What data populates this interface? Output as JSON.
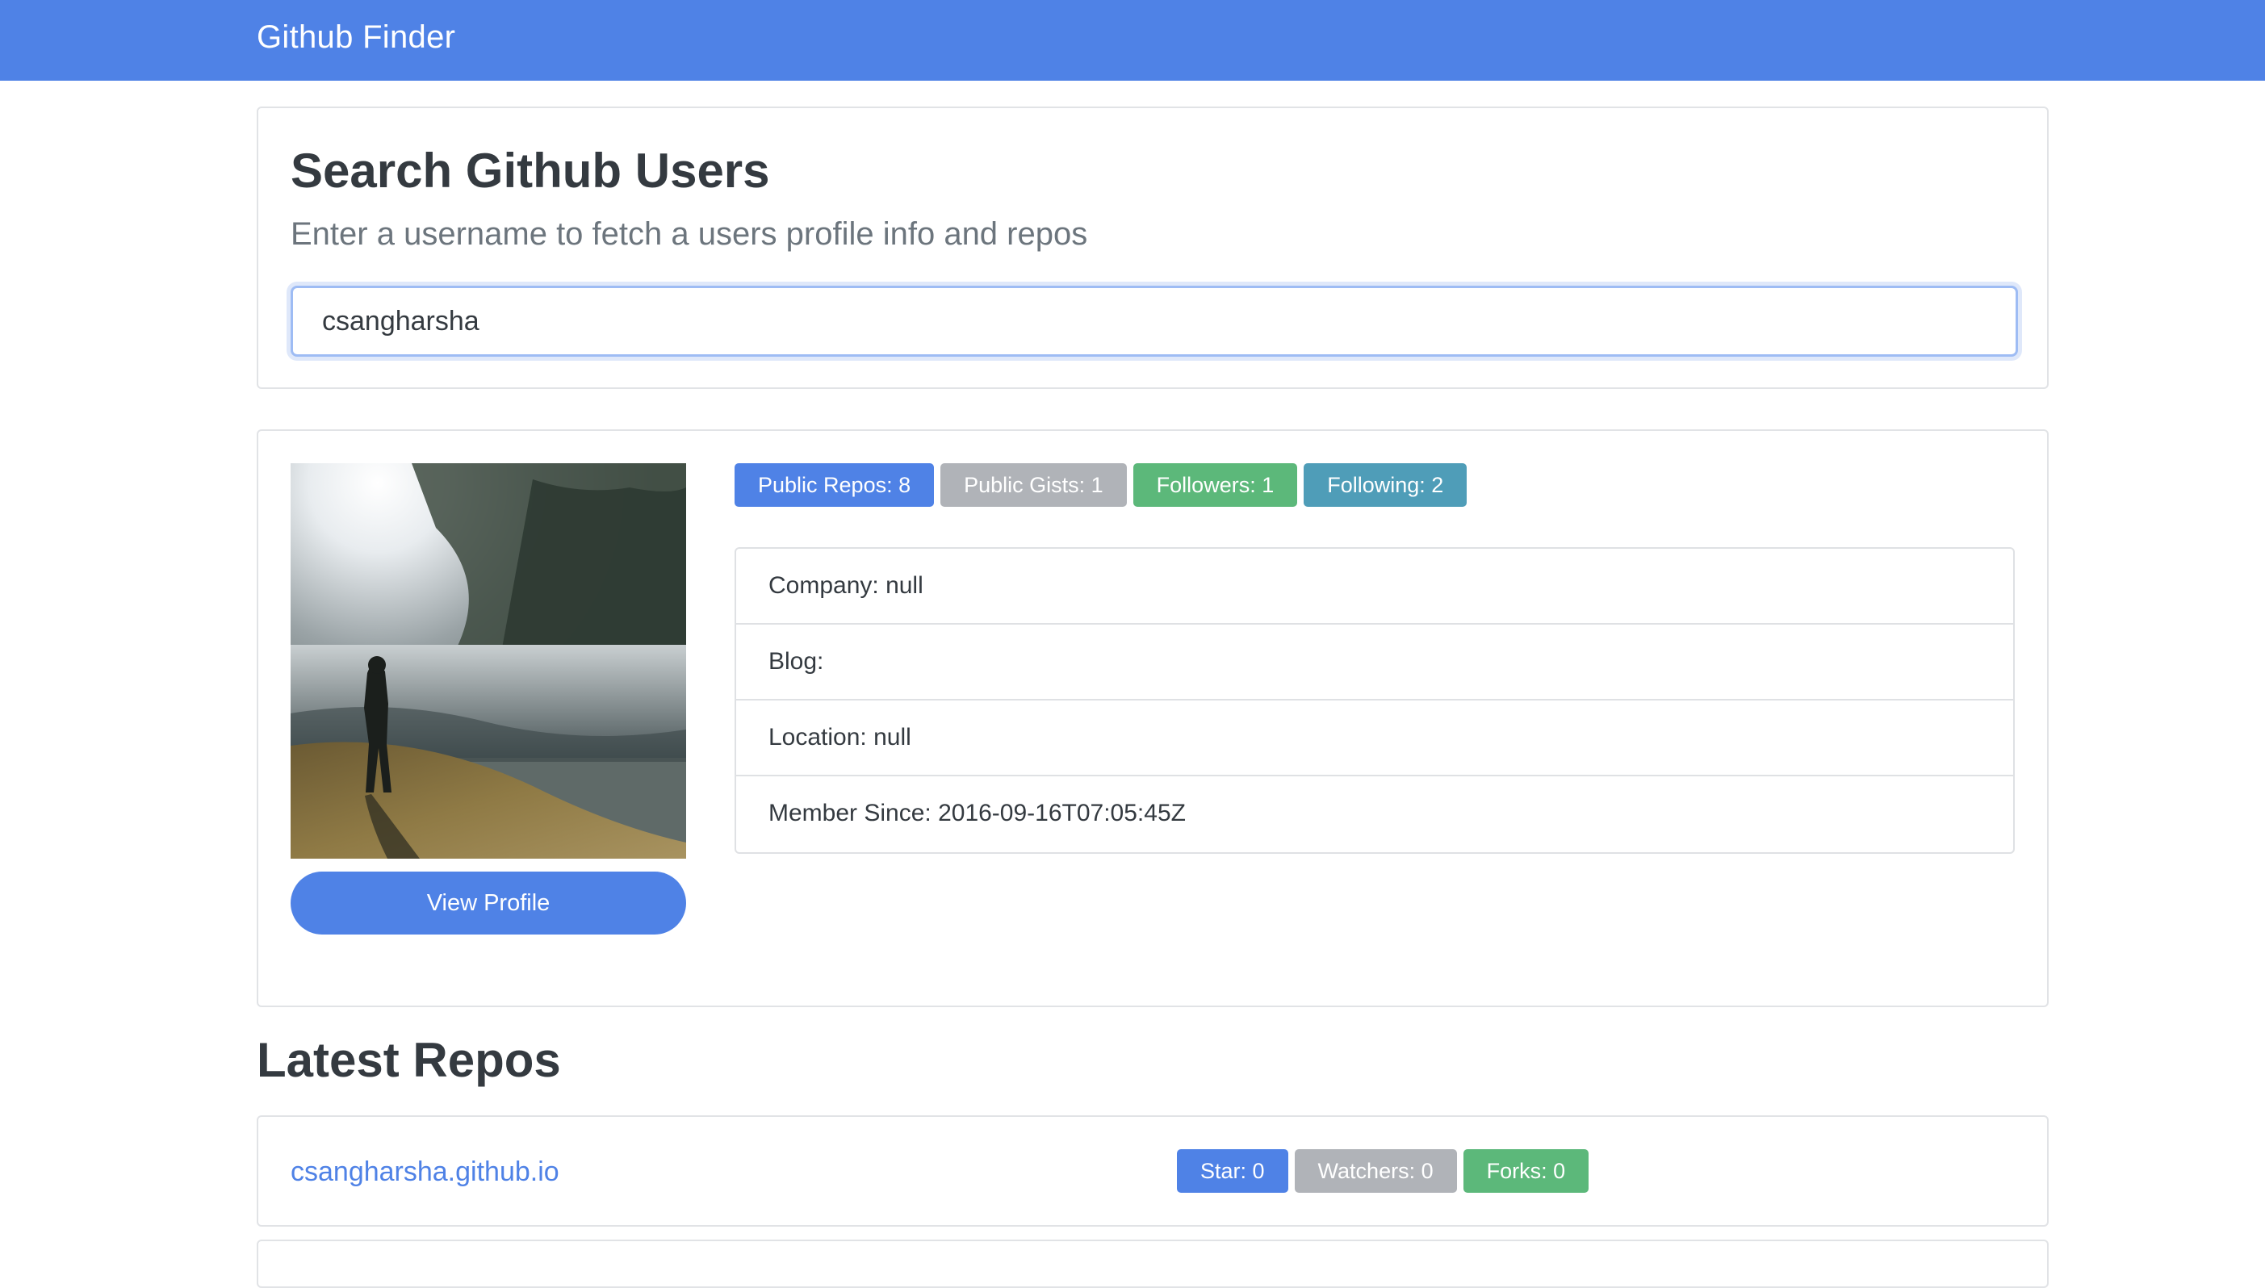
{
  "navbar": {
    "brand": "Github Finder",
    "color": "#4f82e6"
  },
  "search": {
    "title": "Search Github Users",
    "subtitle": "Enter a username to fetch a users profile info and repos",
    "input_value": "csangharsha"
  },
  "profile": {
    "avatar_icon": "user-avatar-photo",
    "view_profile_label": "View Profile",
    "badges": [
      {
        "label": "Public Repos: 8",
        "color": "#4f82e6"
      },
      {
        "label": "Public Gists: 1",
        "color": "#b0b3b8"
      },
      {
        "label": "Followers: 1",
        "color": "#5cb87a"
      },
      {
        "label": "Following: 2",
        "color": "#4f9db8"
      }
    ],
    "info": [
      "Company: null",
      "Blog:",
      "Location: null",
      "Member Since: 2016-09-16T07:05:45Z"
    ]
  },
  "repos": {
    "title": "Latest Repos",
    "items": [
      {
        "name": "csangharsha.github.io",
        "star": "Star: 0",
        "watchers": "Watchers: 0",
        "forks": "Forks: 0"
      }
    ]
  }
}
